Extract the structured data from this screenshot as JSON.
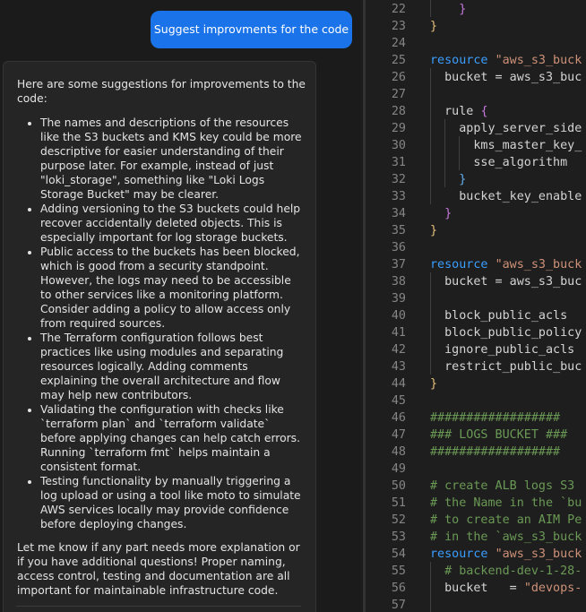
{
  "chat": {
    "user_message": "Suggest improvments for the code",
    "assistant": {
      "intro": "Here are some suggestions for improvements to the code:",
      "bullets": [
        "The names and descriptions of the resources like the S3 buckets and KMS key could be more descriptive for easier understanding of their purpose later. For example, instead of just \"loki_storage\", something like \"Loki Logs Storage Bucket\" may be clearer.",
        "Adding versioning to the S3 buckets could help recover accidentally deleted objects. This is especially important for log storage buckets.",
        "Public access to the buckets has been blocked, which is good from a security standpoint. However, the logs may need to be accessible to other services like a monitoring platform. Consider adding a policy to allow access only from required sources.",
        "The Terraform configuration follows best practices like using modules and separating resources logically. Adding comments explaining the overall architecture and flow may help new contributors.",
        "Validating the configuration with checks like `terraform plan` and `terraform validate` before applying changes can help catch errors. Running `terraform fmt` helps maintain a consistent format.",
        "Testing functionality by manually triggering a log upload or using a tool like moto to simulate AWS services locally may provide confidence before deploying changes."
      ],
      "outro": "Let me know if any part needs more explanation or if you have additional questions! Proper naming, access control, testing and documentation are all important for maintainable infrastructure code."
    }
  },
  "editor": {
    "lines": [
      {
        "n": "22",
        "segs": [
          {
            "t": "    ",
            "c": "ident"
          },
          {
            "t": "}",
            "c": "br2"
          }
        ]
      },
      {
        "n": "23",
        "segs": [
          {
            "t": "}",
            "c": "br1"
          }
        ]
      },
      {
        "n": "24",
        "segs": []
      },
      {
        "n": "25",
        "segs": [
          {
            "t": "resource ",
            "c": "kw"
          },
          {
            "t": "\"aws_s3_buck",
            "c": "str"
          }
        ]
      },
      {
        "n": "26",
        "segs": [
          {
            "t": "  bucket = aws_s3_buc",
            "c": "ident"
          }
        ]
      },
      {
        "n": "27",
        "segs": []
      },
      {
        "n": "28",
        "segs": [
          {
            "t": "  rule ",
            "c": "ident"
          },
          {
            "t": "{",
            "c": "br2"
          }
        ]
      },
      {
        "n": "29",
        "segs": [
          {
            "t": "    apply_server_side",
            "c": "ident"
          }
        ]
      },
      {
        "n": "30",
        "segs": [
          {
            "t": "      kms_master_key_",
            "c": "ident"
          }
        ]
      },
      {
        "n": "31",
        "segs": [
          {
            "t": "      sse_algorithm",
            "c": "ident"
          }
        ]
      },
      {
        "n": "32",
        "segs": [
          {
            "t": "    ",
            "c": "ident"
          },
          {
            "t": "}",
            "c": "br3"
          }
        ]
      },
      {
        "n": "33",
        "segs": [
          {
            "t": "    bucket_key_enable",
            "c": "ident"
          }
        ]
      },
      {
        "n": "34",
        "segs": [
          {
            "t": "  ",
            "c": "ident"
          },
          {
            "t": "}",
            "c": "br2"
          }
        ]
      },
      {
        "n": "35",
        "segs": [
          {
            "t": "}",
            "c": "br1"
          }
        ]
      },
      {
        "n": "36",
        "segs": []
      },
      {
        "n": "37",
        "segs": [
          {
            "t": "resource ",
            "c": "kw"
          },
          {
            "t": "\"aws_s3_buck",
            "c": "str"
          }
        ]
      },
      {
        "n": "38",
        "segs": [
          {
            "t": "  bucket = aws_s3_buc",
            "c": "ident"
          }
        ]
      },
      {
        "n": "39",
        "segs": []
      },
      {
        "n": "40",
        "segs": [
          {
            "t": "  block_public_acls",
            "c": "ident"
          }
        ]
      },
      {
        "n": "41",
        "segs": [
          {
            "t": "  block_public_policy",
            "c": "ident"
          }
        ]
      },
      {
        "n": "42",
        "segs": [
          {
            "t": "  ignore_public_acls",
            "c": "ident"
          }
        ]
      },
      {
        "n": "43",
        "segs": [
          {
            "t": "  restrict_public_buc",
            "c": "ident"
          }
        ]
      },
      {
        "n": "44",
        "segs": [
          {
            "t": "}",
            "c": "br1"
          }
        ]
      },
      {
        "n": "45",
        "segs": []
      },
      {
        "n": "46",
        "segs": [
          {
            "t": "##################",
            "c": "cm"
          }
        ]
      },
      {
        "n": "47",
        "segs": [
          {
            "t": "### LOGS BUCKET ###",
            "c": "cm"
          }
        ]
      },
      {
        "n": "48",
        "segs": [
          {
            "t": "##################",
            "c": "cm"
          }
        ]
      },
      {
        "n": "49",
        "segs": []
      },
      {
        "n": "50",
        "segs": [
          {
            "t": "# create ALB logs S3",
            "c": "cm"
          }
        ]
      },
      {
        "n": "51",
        "segs": [
          {
            "t": "# the Name in the `bu",
            "c": "cm"
          }
        ]
      },
      {
        "n": "52",
        "segs": [
          {
            "t": "# to create an AIM Pe",
            "c": "cm"
          }
        ]
      },
      {
        "n": "53",
        "segs": [
          {
            "t": "# in the `aws_s3_buck",
            "c": "cm"
          }
        ]
      },
      {
        "n": "54",
        "segs": [
          {
            "t": "resource ",
            "c": "kw"
          },
          {
            "t": "\"aws_s3_buck",
            "c": "str"
          }
        ]
      },
      {
        "n": "55",
        "segs": [
          {
            "t": "  # backend-dev-1-28-",
            "c": "cm"
          }
        ]
      },
      {
        "n": "56",
        "segs": [
          {
            "t": "  bucket   = ",
            "c": "ident"
          },
          {
            "t": "\"devops-",
            "c": "str"
          }
        ]
      },
      {
        "n": "57",
        "segs": []
      }
    ]
  }
}
